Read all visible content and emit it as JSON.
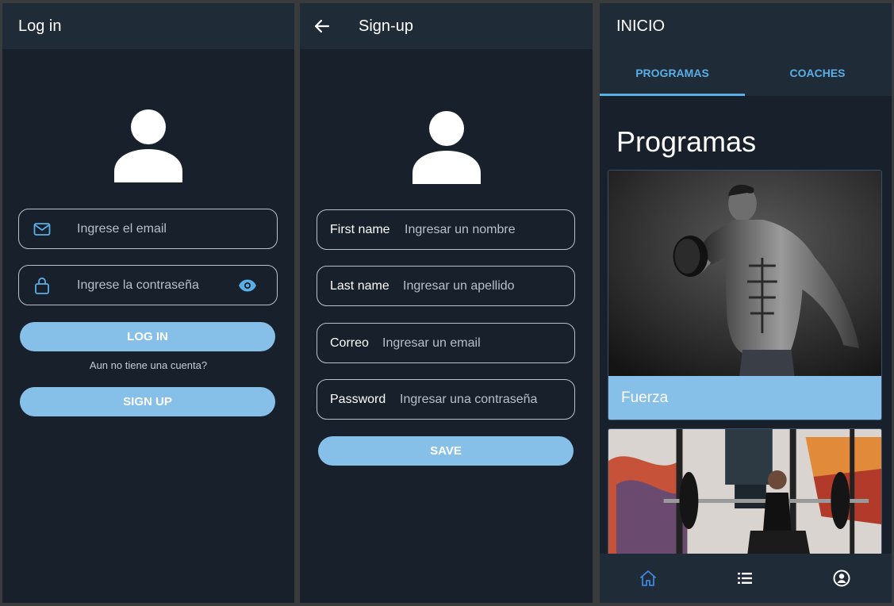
{
  "login": {
    "title": "Log in",
    "email_placeholder": "Ingrese el email",
    "password_placeholder": "Ingrese la contraseña",
    "login_button": "LOG IN",
    "no_account_text": "Aun no tiene una cuenta?",
    "signup_button": "SIGN UP"
  },
  "signup": {
    "title": "Sign-up",
    "fields": [
      {
        "label": "First name",
        "placeholder": "Ingresar un nombre"
      },
      {
        "label": "Last name",
        "placeholder": "Ingresar un apellido"
      },
      {
        "label": "Correo",
        "placeholder": "Ingresar un email"
      },
      {
        "label": "Password",
        "placeholder": "Ingresar una contraseña"
      }
    ],
    "save_button": "SAVE"
  },
  "home": {
    "title": "INICIO",
    "tabs": [
      {
        "label": "PROGRAMAS",
        "active": true
      },
      {
        "label": "COACHES",
        "active": false
      }
    ],
    "section_title": "Programas",
    "programs": [
      {
        "name": "Fuerza"
      }
    ],
    "bottom_nav": [
      {
        "icon": "home-icon",
        "active": true
      },
      {
        "icon": "list-icon",
        "active": false
      },
      {
        "icon": "account-circle-icon",
        "active": false
      }
    ]
  },
  "colors": {
    "background": "#18202b",
    "appbar": "#202b38",
    "accent": "#86bfe8",
    "tab_accent": "#5aaee6",
    "active_nav": "#3f86e0"
  }
}
